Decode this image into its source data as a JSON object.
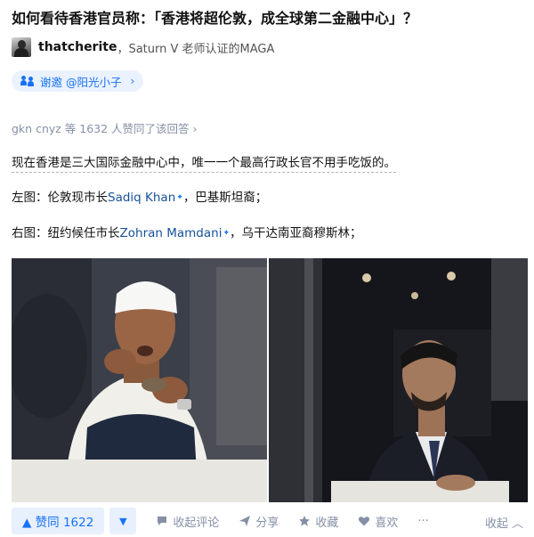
{
  "question": {
    "title": "如何看待香港官员称：「香港将超伦敦，成全球第二金融中心」？"
  },
  "author": {
    "name": "thatcherite",
    "bio": "，Saturn V 老师认证的MAGA"
  },
  "invite": {
    "label": "谢邀 @阳光小子",
    "chevron": "›"
  },
  "voters": {
    "text": "gkn cnyz 等 1632 人赞同了该回答 ›"
  },
  "content": {
    "p1": "现在香港是三大国际金融中心中，唯一一个最高行政长官不用手吃饭的。",
    "p2_prefix": "左图：伦敦现市长",
    "p2_link": "Sadiq Khan",
    "p2_plus": "✦",
    "p2_suffix": "，巴基斯坦裔；",
    "p3_prefix": "右图：纽约候任市长",
    "p3_link": "Zohran Mamdani",
    "p3_plus": "✦",
    "p3_suffix": "，乌干达南亚裔穆斯林；"
  },
  "actions": {
    "vote_up": "▲ 赞同 1622",
    "vote_down": "▼",
    "comments": "收起评论",
    "share": "分享",
    "favorite": "收藏",
    "like": "喜欢",
    "more": "···",
    "collapse": "收起",
    "collapse_icon": "︿"
  },
  "icons": {
    "comment": "comment-icon",
    "share": "share-icon",
    "star": "star-icon",
    "heart": "heart-icon"
  },
  "colors": {
    "accent": "#1772f6",
    "link": "#175199",
    "muted": "#8590a6"
  }
}
